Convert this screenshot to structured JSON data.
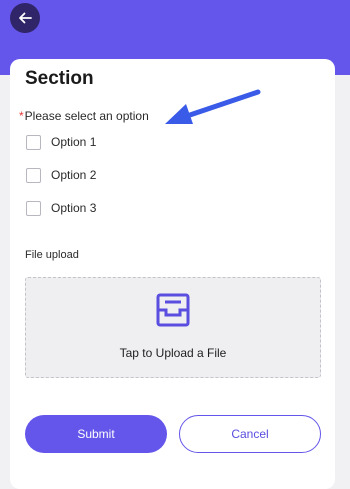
{
  "header": {
    "back_icon": "arrow-left-icon",
    "color": "#6456ea"
  },
  "form": {
    "section_title": "Section",
    "question": {
      "required_marker": "*",
      "label": "Please select an option",
      "options": [
        "Option 1",
        "Option 2",
        "Option 3"
      ]
    },
    "file_upload": {
      "label": "File upload",
      "prompt": "Tap to Upload a File",
      "icon": "upload-tray-icon"
    }
  },
  "buttons": {
    "submit_label": "Submit",
    "cancel_label": "Cancel"
  },
  "annotation": {
    "arrow_color": "#3a5ae8"
  },
  "colors": {
    "accent": "#6456ea",
    "required": "#e53935"
  }
}
